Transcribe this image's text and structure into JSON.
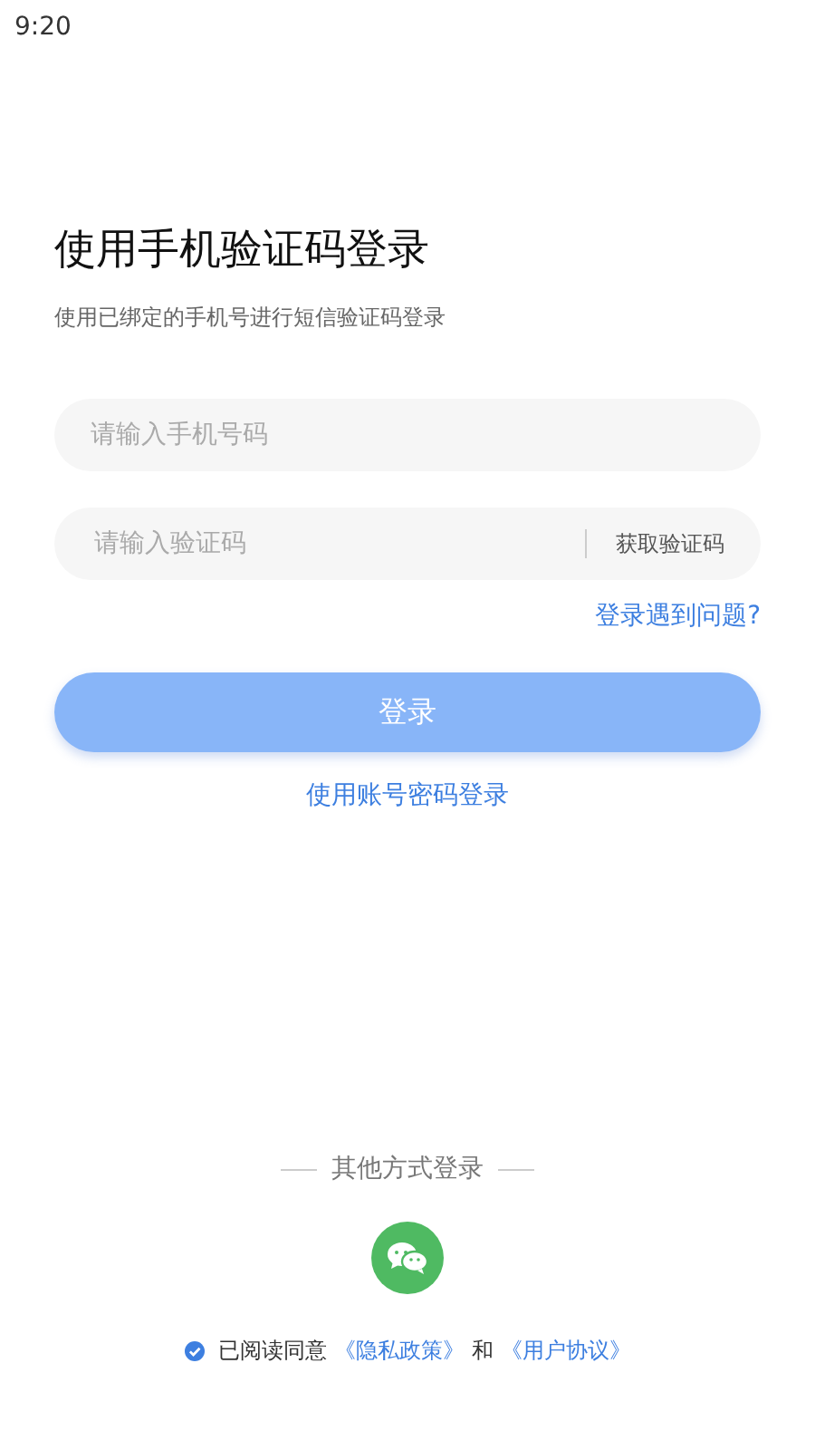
{
  "status_bar": {
    "time": "9:20"
  },
  "title": "使用手机验证码登录",
  "subtitle": "使用已绑定的手机号进行短信验证码登录",
  "phone_field": {
    "placeholder": "请输入手机号码"
  },
  "code_field": {
    "placeholder": "请输入验证码",
    "action": "获取验证码"
  },
  "help_link": "登录遇到问题?",
  "login_button": {
    "label": "登录",
    "disabled": true
  },
  "alt_link": "使用账号密码登录",
  "other_login": {
    "label": "其他方式登录"
  },
  "agreement": {
    "checked": true,
    "parts": [
      {
        "kind": "text",
        "text": "已阅读同意"
      },
      {
        "kind": "link",
        "text": "《隐私政策》"
      },
      {
        "kind": "text",
        "text": "和"
      },
      {
        "kind": "link",
        "text": "《用户协议》"
      }
    ]
  }
}
